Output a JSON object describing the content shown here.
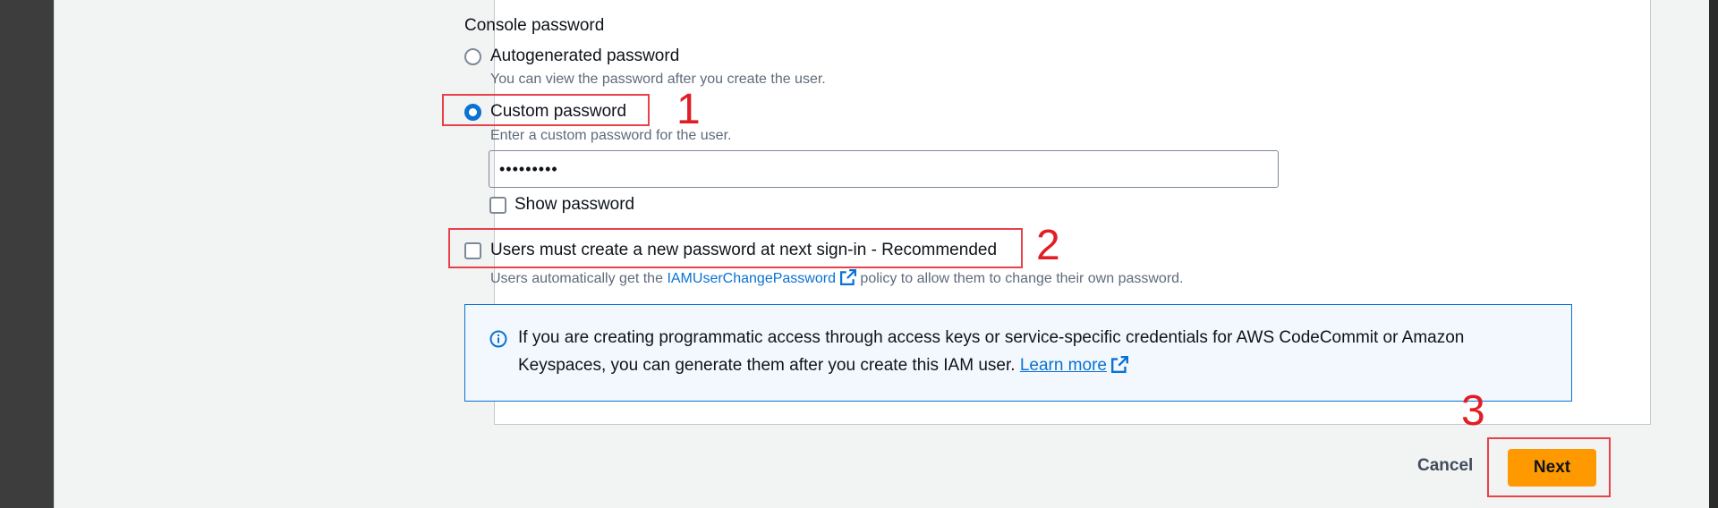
{
  "form": {
    "console_password_label": "Console password",
    "auto_label": "Autogenerated password",
    "auto_desc": "You can view the password after you create the user.",
    "custom_label": "Custom password",
    "custom_desc": "Enter a custom password for the user.",
    "password_value": "•••••••••",
    "show_password_label": "Show password",
    "must_change_label": "Users must create a new password at next sign-in - Recommended",
    "must_change_desc_pre": "Users automatically get the",
    "must_change_desc_link": "IAMUserChangePassword",
    "must_change_desc_post": "policy to allow them to change their own password.",
    "selected_option": "Custom password",
    "show_password_checked": false,
    "must_change_checked": false
  },
  "info": {
    "text": "If you are creating programmatic access through access keys or service-specific credentials for AWS CodeCommit or Amazon Keyspaces, you can generate them after you create this IAM user.",
    "link": "Learn more"
  },
  "footer": {
    "cancel_label": "Cancel",
    "next_label": "Next"
  },
  "annotations": {
    "one": "1",
    "two": "2",
    "three": "3"
  },
  "colors": {
    "accent": "#0972d3",
    "primary_button": "#ff9900",
    "annotation": "#e21d26"
  }
}
